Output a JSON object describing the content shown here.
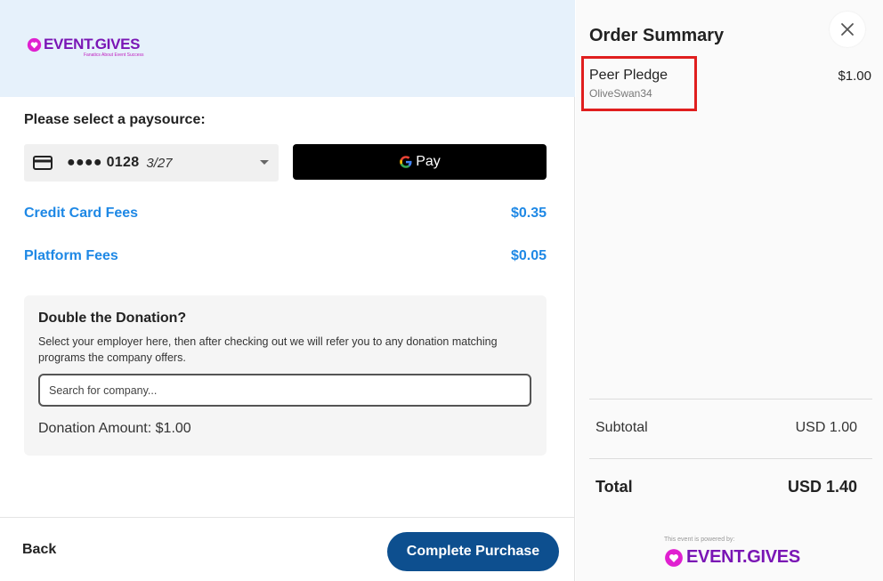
{
  "header": {
    "logo_text": "EVENT.GIVES",
    "logo_tagline": "Fanatics About Event Success"
  },
  "payment": {
    "label": "Please select a paysource:",
    "card_number": "●●●● 0128",
    "card_expiry": "3/27",
    "gpay_label": "Pay"
  },
  "fees": {
    "credit_card_label": "Credit Card Fees",
    "credit_card_value": "$0.35",
    "platform_label": "Platform Fees",
    "platform_value": "$0.05"
  },
  "donation": {
    "title": "Double the Donation?",
    "description": "Select your employer here, then after checking out we will refer you to any donation matching programs the company offers.",
    "search_placeholder": "Search for company...",
    "amount": "Donation Amount: $1.00"
  },
  "footer": {
    "back_label": "Back",
    "complete_label": "Complete Purchase"
  },
  "summary": {
    "title": "Order Summary",
    "items": [
      {
        "name": "Peer Pledge",
        "sub": "OliveSwan34",
        "price": "$1.00"
      }
    ],
    "subtotal_label": "Subtotal",
    "subtotal_value": "USD 1.00",
    "total_label": "Total",
    "total_value": "USD 1.40",
    "powered_by": "This event is powered by:",
    "brand": "EVENT.GIVES"
  },
  "colors": {
    "brand_purple": "#7a16b5",
    "brand_pink": "#e020d0",
    "accent_blue": "#1e88e5",
    "button_blue": "#0d4f8f",
    "highlight_red": "#e01e1e"
  }
}
